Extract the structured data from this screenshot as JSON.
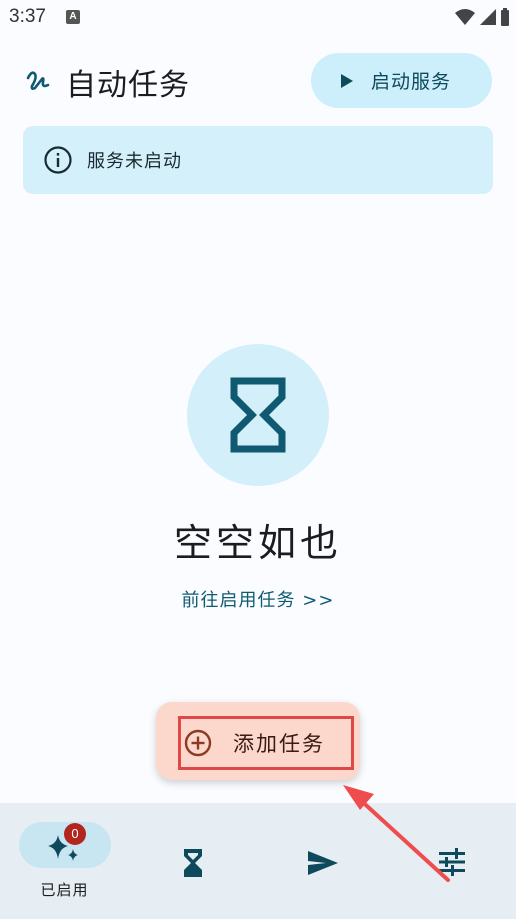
{
  "status": {
    "time": "3:37",
    "indicator": "A"
  },
  "header": {
    "title": "自动任务",
    "start_button": "启动服务"
  },
  "banner": {
    "text": "服务未启动",
    "icon": "info-icon"
  },
  "empty": {
    "title": "空空如也",
    "link": "前往启用任务 >>",
    "icon": "hourglass-icon"
  },
  "fab": {
    "label": "添加任务",
    "icon": "add-circle-icon"
  },
  "nav": {
    "items": [
      {
        "label": "已启用",
        "icon": "sparkle-icon",
        "badge": "0",
        "active": true
      },
      {
        "label": "",
        "icon": "hourglass-icon"
      },
      {
        "label": "",
        "icon": "send-icon"
      },
      {
        "label": "",
        "icon": "tune-icon"
      }
    ]
  },
  "colors": {
    "accent": "#0f5a70",
    "banner": "#d4f0fb",
    "fab": "#fbd7cc",
    "annotation": "#e04848"
  }
}
